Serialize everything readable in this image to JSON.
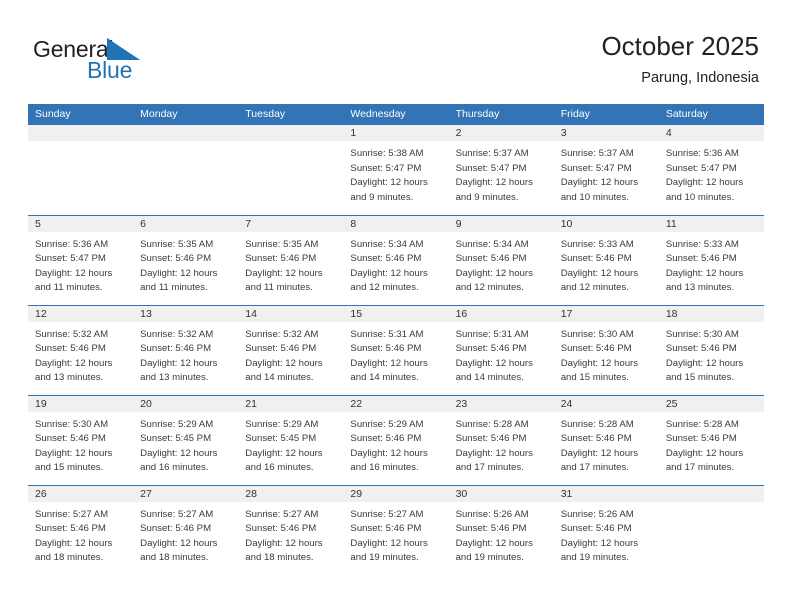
{
  "brand": {
    "name_part1": "General",
    "name_part2": "Blue",
    "flag_icon": "triangle-flag-icon",
    "accent_color": "#1f73b7"
  },
  "header": {
    "title": "October 2025",
    "subtitle": "Parung, Indonesia"
  },
  "calendar": {
    "header_bg_color": "#3274b6",
    "daynum_band_color": "#f0f0f0",
    "weekday_headers": [
      "Sunday",
      "Monday",
      "Tuesday",
      "Wednesday",
      "Thursday",
      "Friday",
      "Saturday"
    ],
    "weeks": [
      [
        {
          "day": "",
          "empty": true
        },
        {
          "day": "",
          "empty": true
        },
        {
          "day": "",
          "empty": true
        },
        {
          "day": "1",
          "sunrise": "Sunrise: 5:38 AM",
          "sunset": "Sunset: 5:47 PM",
          "daylight_line1": "Daylight: 12 hours",
          "daylight_line2": "and 9 minutes."
        },
        {
          "day": "2",
          "sunrise": "Sunrise: 5:37 AM",
          "sunset": "Sunset: 5:47 PM",
          "daylight_line1": "Daylight: 12 hours",
          "daylight_line2": "and 9 minutes."
        },
        {
          "day": "3",
          "sunrise": "Sunrise: 5:37 AM",
          "sunset": "Sunset: 5:47 PM",
          "daylight_line1": "Daylight: 12 hours",
          "daylight_line2": "and 10 minutes."
        },
        {
          "day": "4",
          "sunrise": "Sunrise: 5:36 AM",
          "sunset": "Sunset: 5:47 PM",
          "daylight_line1": "Daylight: 12 hours",
          "daylight_line2": "and 10 minutes."
        }
      ],
      [
        {
          "day": "5",
          "sunrise": "Sunrise: 5:36 AM",
          "sunset": "Sunset: 5:47 PM",
          "daylight_line1": "Daylight: 12 hours",
          "daylight_line2": "and 11 minutes."
        },
        {
          "day": "6",
          "sunrise": "Sunrise: 5:35 AM",
          "sunset": "Sunset: 5:46 PM",
          "daylight_line1": "Daylight: 12 hours",
          "daylight_line2": "and 11 minutes."
        },
        {
          "day": "7",
          "sunrise": "Sunrise: 5:35 AM",
          "sunset": "Sunset: 5:46 PM",
          "daylight_line1": "Daylight: 12 hours",
          "daylight_line2": "and 11 minutes."
        },
        {
          "day": "8",
          "sunrise": "Sunrise: 5:34 AM",
          "sunset": "Sunset: 5:46 PM",
          "daylight_line1": "Daylight: 12 hours",
          "daylight_line2": "and 12 minutes."
        },
        {
          "day": "9",
          "sunrise": "Sunrise: 5:34 AM",
          "sunset": "Sunset: 5:46 PM",
          "daylight_line1": "Daylight: 12 hours",
          "daylight_line2": "and 12 minutes."
        },
        {
          "day": "10",
          "sunrise": "Sunrise: 5:33 AM",
          "sunset": "Sunset: 5:46 PM",
          "daylight_line1": "Daylight: 12 hours",
          "daylight_line2": "and 12 minutes."
        },
        {
          "day": "11",
          "sunrise": "Sunrise: 5:33 AM",
          "sunset": "Sunset: 5:46 PM",
          "daylight_line1": "Daylight: 12 hours",
          "daylight_line2": "and 13 minutes."
        }
      ],
      [
        {
          "day": "12",
          "sunrise": "Sunrise: 5:32 AM",
          "sunset": "Sunset: 5:46 PM",
          "daylight_line1": "Daylight: 12 hours",
          "daylight_line2": "and 13 minutes."
        },
        {
          "day": "13",
          "sunrise": "Sunrise: 5:32 AM",
          "sunset": "Sunset: 5:46 PM",
          "daylight_line1": "Daylight: 12 hours",
          "daylight_line2": "and 13 minutes."
        },
        {
          "day": "14",
          "sunrise": "Sunrise: 5:32 AM",
          "sunset": "Sunset: 5:46 PM",
          "daylight_line1": "Daylight: 12 hours",
          "daylight_line2": "and 14 minutes."
        },
        {
          "day": "15",
          "sunrise": "Sunrise: 5:31 AM",
          "sunset": "Sunset: 5:46 PM",
          "daylight_line1": "Daylight: 12 hours",
          "daylight_line2": "and 14 minutes."
        },
        {
          "day": "16",
          "sunrise": "Sunrise: 5:31 AM",
          "sunset": "Sunset: 5:46 PM",
          "daylight_line1": "Daylight: 12 hours",
          "daylight_line2": "and 14 minutes."
        },
        {
          "day": "17",
          "sunrise": "Sunrise: 5:30 AM",
          "sunset": "Sunset: 5:46 PM",
          "daylight_line1": "Daylight: 12 hours",
          "daylight_line2": "and 15 minutes."
        },
        {
          "day": "18",
          "sunrise": "Sunrise: 5:30 AM",
          "sunset": "Sunset: 5:46 PM",
          "daylight_line1": "Daylight: 12 hours",
          "daylight_line2": "and 15 minutes."
        }
      ],
      [
        {
          "day": "19",
          "sunrise": "Sunrise: 5:30 AM",
          "sunset": "Sunset: 5:46 PM",
          "daylight_line1": "Daylight: 12 hours",
          "daylight_line2": "and 15 minutes."
        },
        {
          "day": "20",
          "sunrise": "Sunrise: 5:29 AM",
          "sunset": "Sunset: 5:45 PM",
          "daylight_line1": "Daylight: 12 hours",
          "daylight_line2": "and 16 minutes."
        },
        {
          "day": "21",
          "sunrise": "Sunrise: 5:29 AM",
          "sunset": "Sunset: 5:45 PM",
          "daylight_line1": "Daylight: 12 hours",
          "daylight_line2": "and 16 minutes."
        },
        {
          "day": "22",
          "sunrise": "Sunrise: 5:29 AM",
          "sunset": "Sunset: 5:46 PM",
          "daylight_line1": "Daylight: 12 hours",
          "daylight_line2": "and 16 minutes."
        },
        {
          "day": "23",
          "sunrise": "Sunrise: 5:28 AM",
          "sunset": "Sunset: 5:46 PM",
          "daylight_line1": "Daylight: 12 hours",
          "daylight_line2": "and 17 minutes."
        },
        {
          "day": "24",
          "sunrise": "Sunrise: 5:28 AM",
          "sunset": "Sunset: 5:46 PM",
          "daylight_line1": "Daylight: 12 hours",
          "daylight_line2": "and 17 minutes."
        },
        {
          "day": "25",
          "sunrise": "Sunrise: 5:28 AM",
          "sunset": "Sunset: 5:46 PM",
          "daylight_line1": "Daylight: 12 hours",
          "daylight_line2": "and 17 minutes."
        }
      ],
      [
        {
          "day": "26",
          "sunrise": "Sunrise: 5:27 AM",
          "sunset": "Sunset: 5:46 PM",
          "daylight_line1": "Daylight: 12 hours",
          "daylight_line2": "and 18 minutes."
        },
        {
          "day": "27",
          "sunrise": "Sunrise: 5:27 AM",
          "sunset": "Sunset: 5:46 PM",
          "daylight_line1": "Daylight: 12 hours",
          "daylight_line2": "and 18 minutes."
        },
        {
          "day": "28",
          "sunrise": "Sunrise: 5:27 AM",
          "sunset": "Sunset: 5:46 PM",
          "daylight_line1": "Daylight: 12 hours",
          "daylight_line2": "and 18 minutes."
        },
        {
          "day": "29",
          "sunrise": "Sunrise: 5:27 AM",
          "sunset": "Sunset: 5:46 PM",
          "daylight_line1": "Daylight: 12 hours",
          "daylight_line2": "and 19 minutes."
        },
        {
          "day": "30",
          "sunrise": "Sunrise: 5:26 AM",
          "sunset": "Sunset: 5:46 PM",
          "daylight_line1": "Daylight: 12 hours",
          "daylight_line2": "and 19 minutes."
        },
        {
          "day": "31",
          "sunrise": "Sunrise: 5:26 AM",
          "sunset": "Sunset: 5:46 PM",
          "daylight_line1": "Daylight: 12 hours",
          "daylight_line2": "and 19 minutes."
        },
        {
          "day": "",
          "empty": true
        }
      ]
    ]
  }
}
